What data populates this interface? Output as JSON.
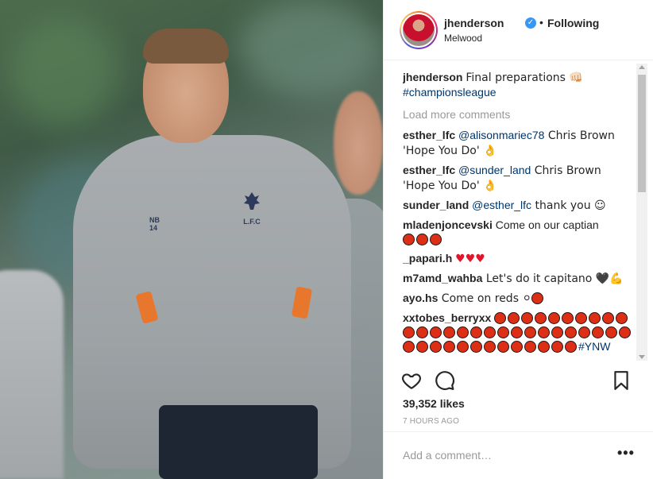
{
  "post": {
    "username": "jhenderson",
    "follow_status": "Following",
    "separator": "•",
    "location": "Melwood",
    "verified_glyph": "✓"
  },
  "photo": {
    "sponsor_text": "NB",
    "shirt_number": "14",
    "crest_text": "L.F.C"
  },
  "caption": {
    "user": "jhenderson",
    "text": "Final preparations 👊🏻",
    "hashtag": "#championsleague"
  },
  "load_more_label": "Load more comments",
  "comments": [
    {
      "user": "esther_lfc",
      "mention": "@alisonmariec78",
      "text": " Chris Brown 'Hope You Do' 👌"
    },
    {
      "user": "esther_lfc",
      "mention": "@sunder_land",
      "text": " Chris Brown 'Hope You Do' 👌"
    },
    {
      "user": "sunder_land",
      "mention": "@esther_lfc",
      "text": " thank you ☺"
    },
    {
      "user": "mladenjoncevski",
      "mention": "",
      "text": " Come on our captian"
    },
    {
      "user": "_papari.h",
      "mention": "",
      "text": " "
    },
    {
      "user": "m7amd_wahba",
      "mention": "",
      "text": " Let's do it capitano 🖤💪"
    },
    {
      "user": "ayo.hs",
      "mention": "",
      "text": " Come on reds ⚪"
    },
    {
      "user": "xxtobes_berryxx",
      "mention": "",
      "text": " ",
      "hashtag": "#YNW"
    }
  ],
  "comment_emoji": {
    "mladen_dots": 3,
    "papari_hearts": "♥♥♥",
    "ayo_dots": 1,
    "xxtobes_dots": 40
  },
  "actions": {
    "like_icon": "heart-outline-icon",
    "comment_icon": "speech-bubble-icon",
    "save_icon": "bookmark-icon"
  },
  "likes_text": "39,352 likes",
  "time_text": "7 HOURS AGO",
  "add_comment": {
    "placeholder": "Add a comment…",
    "more_label": "•••"
  },
  "colors": {
    "link": "#003569",
    "muted": "#999999",
    "verified": "#3897f0",
    "text": "#262626"
  }
}
